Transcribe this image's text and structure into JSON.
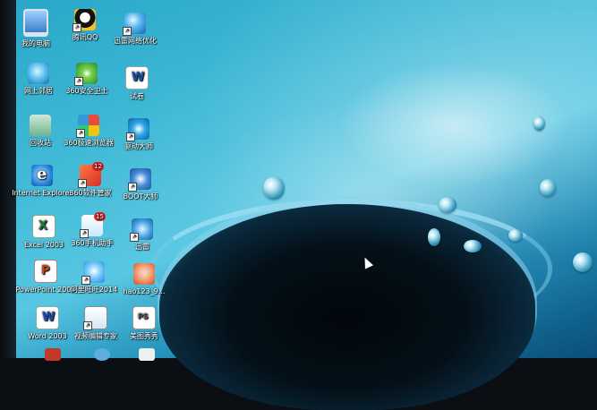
{
  "desktop": {
    "icons": [
      {
        "id": "my-computer",
        "label": "我的电脑"
      },
      {
        "id": "qq",
        "label": "腾讯QQ"
      },
      {
        "id": "net-optimizer",
        "label": "迅雷网络优化"
      },
      {
        "id": "network-neighborhood",
        "label": "网上邻居"
      },
      {
        "id": "360-safe",
        "label": "360安全卫士"
      },
      {
        "id": "test-doc",
        "label": "试卷"
      },
      {
        "id": "recycle-bin",
        "label": "回收站"
      },
      {
        "id": "360-browser",
        "label": "360极速浏览器"
      },
      {
        "id": "driver-master",
        "label": "驱动大师"
      },
      {
        "id": "internet-explorer",
        "label": "Internet Explorer"
      },
      {
        "id": "360-software",
        "label": "360软件管家"
      },
      {
        "id": "boot-master",
        "label": "BOOT大师"
      },
      {
        "id": "excel-2003",
        "label": "Excel 2003"
      },
      {
        "id": "360-phone",
        "label": "360手机助手"
      },
      {
        "id": "xunlei",
        "label": "迅雷"
      },
      {
        "id": "powerpoint-2003",
        "label": "PowerPoint 2003"
      },
      {
        "id": "aliwangwang",
        "label": "阿里旺旺2014"
      },
      {
        "id": "hao123",
        "label": "hao123_9..."
      },
      {
        "id": "word-2003",
        "label": "Word 2003"
      },
      {
        "id": "video-maker",
        "label": "视频编辑专家"
      },
      {
        "id": "meitu",
        "label": "美图秀秀"
      }
    ],
    "badges": {
      "softmgr": "12",
      "phone360": "15"
    }
  }
}
